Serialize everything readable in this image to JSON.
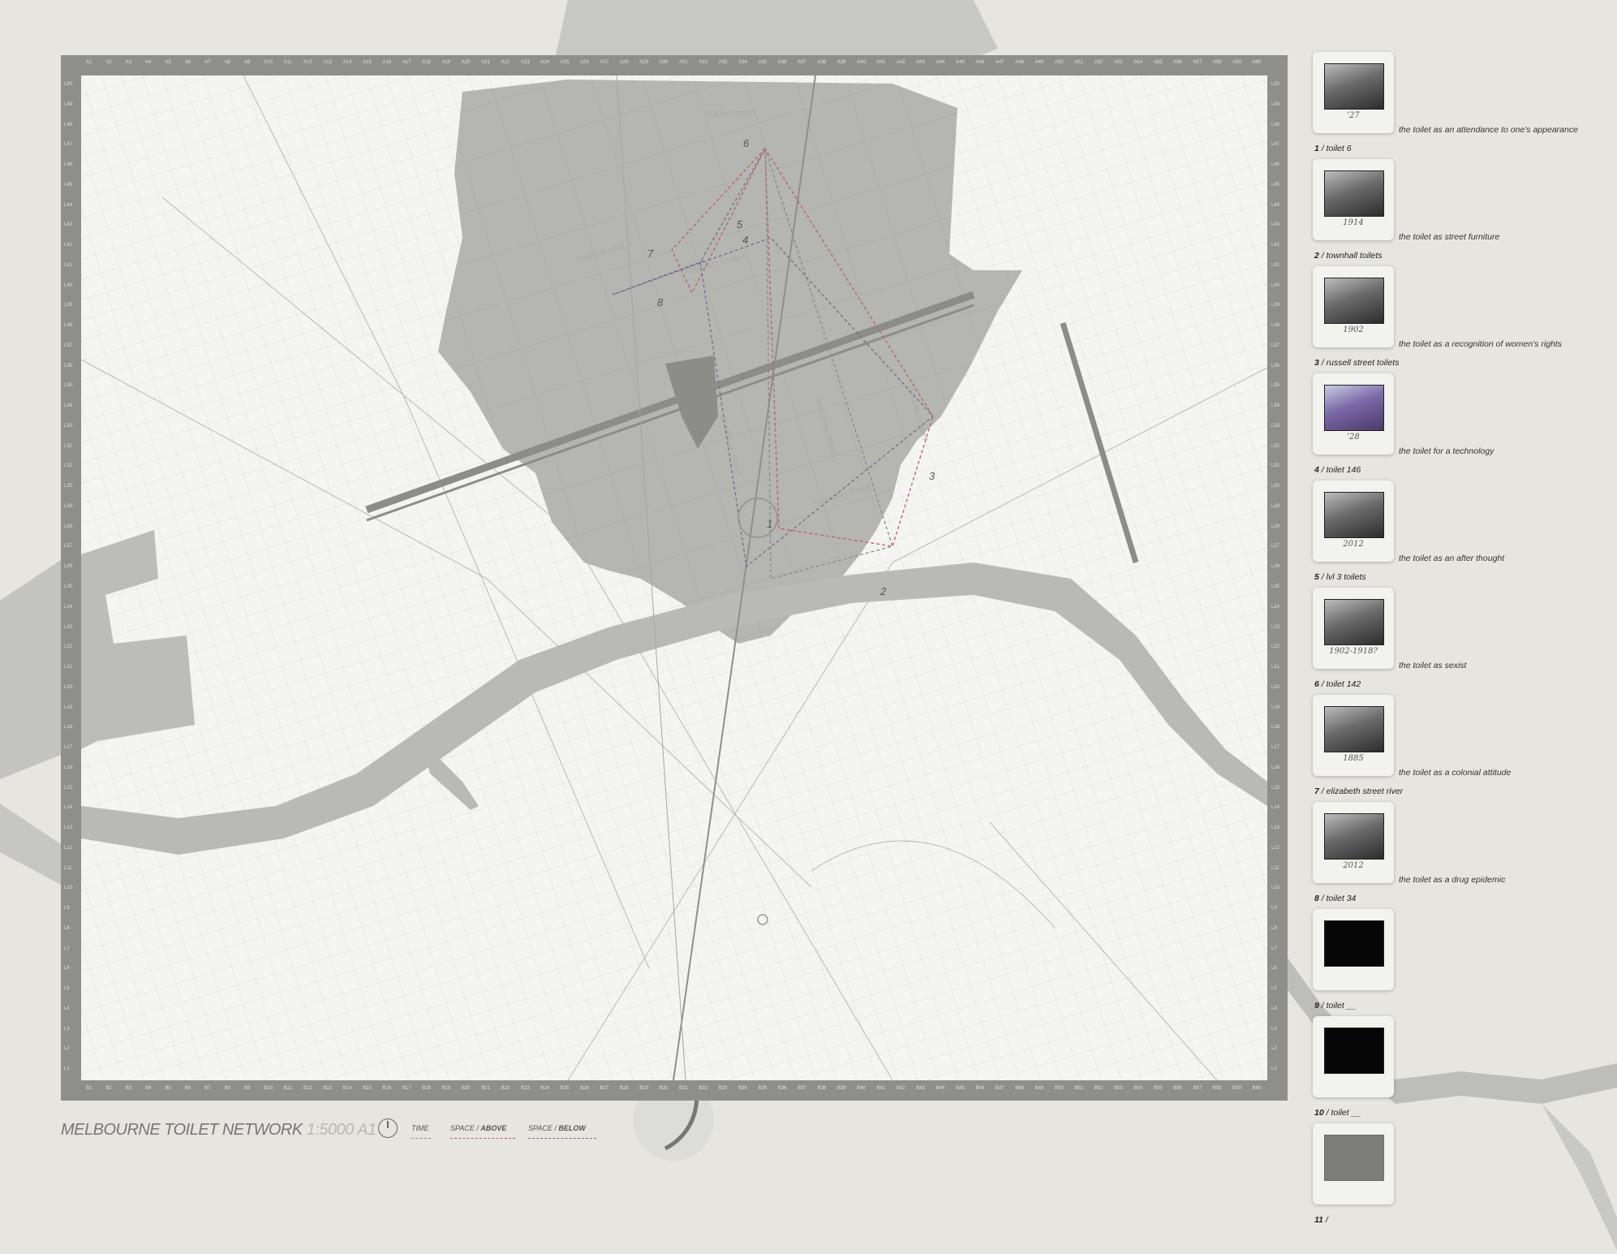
{
  "map": {
    "title": "MELBOURNE TOILET NETWORK",
    "scale_text": "1:5000 A1",
    "north_icon": "north-arrow-icon",
    "legend": [
      {
        "label_plain": "TIME",
        "label_bold": "",
        "color": "#8a8a8a"
      },
      {
        "label_plain": "SPACE / ",
        "label_bold": "ABOVE",
        "color": "#c06060"
      },
      {
        "label_plain": "SPACE / ",
        "label_bold": "BELOW",
        "color": "#707090"
      }
    ],
    "street_labels": [
      "QUEEN STREET",
      "FRANKLIN STREET",
      "A'BECKETT STREET",
      "ELIZABETH STREET",
      "LONSDALE STREET",
      "SWANSTON STREET",
      "COLLINS STREET"
    ],
    "toilet_nodes": [
      "1",
      "2",
      "3",
      "4",
      "5",
      "6",
      "7",
      "8"
    ],
    "colors": {
      "frame": "#8e8e8a",
      "map_bg": "#f4f4f2",
      "cbd_shade": "#aeaeab",
      "river": "#b9b9b6",
      "time_line": "#8a8a8a",
      "above_line": "#c06060",
      "below_line": "#707090"
    }
  },
  "cards": [
    {
      "number": "1",
      "name": "toilet 6",
      "caption": "the toilet as an attendance to one's appearance",
      "year": "'27",
      "photo": "bw"
    },
    {
      "number": "2",
      "name": "townhall toilets",
      "caption": "the toilet as street furniture",
      "year": "1914",
      "photo": "bw"
    },
    {
      "number": "3",
      "name": "russell street toilets",
      "caption": "the toilet as a recognition of women's rights",
      "year": "1902",
      "photo": "bw"
    },
    {
      "number": "4",
      "name": "toilet 146",
      "caption": "the toilet for a technology",
      "year": "'28",
      "photo": "color"
    },
    {
      "number": "5",
      "name": "lvl 3 toilets",
      "caption": "the toilet as an after thought",
      "year": "2012",
      "photo": "bw"
    },
    {
      "number": "6",
      "name": "toilet 142",
      "caption": "the toilet as sexist",
      "year": "1902-1918?",
      "photo": "bw"
    },
    {
      "number": "7",
      "name": "elizabeth street river",
      "caption": "the toilet as a colonial attitude",
      "year": "1885",
      "photo": "bw"
    },
    {
      "number": "8",
      "name": "toilet 34",
      "caption": "the toilet as a drug epidemic",
      "year": "2012",
      "photo": "bw"
    },
    {
      "number": "9",
      "name": "toilet __",
      "caption": "",
      "year": "",
      "photo": "black"
    },
    {
      "number": "10",
      "name": "toilet __",
      "caption": "",
      "year": "",
      "photo": "black"
    },
    {
      "number": "11",
      "name": "",
      "caption": "",
      "year": "",
      "photo": "grey"
    }
  ]
}
